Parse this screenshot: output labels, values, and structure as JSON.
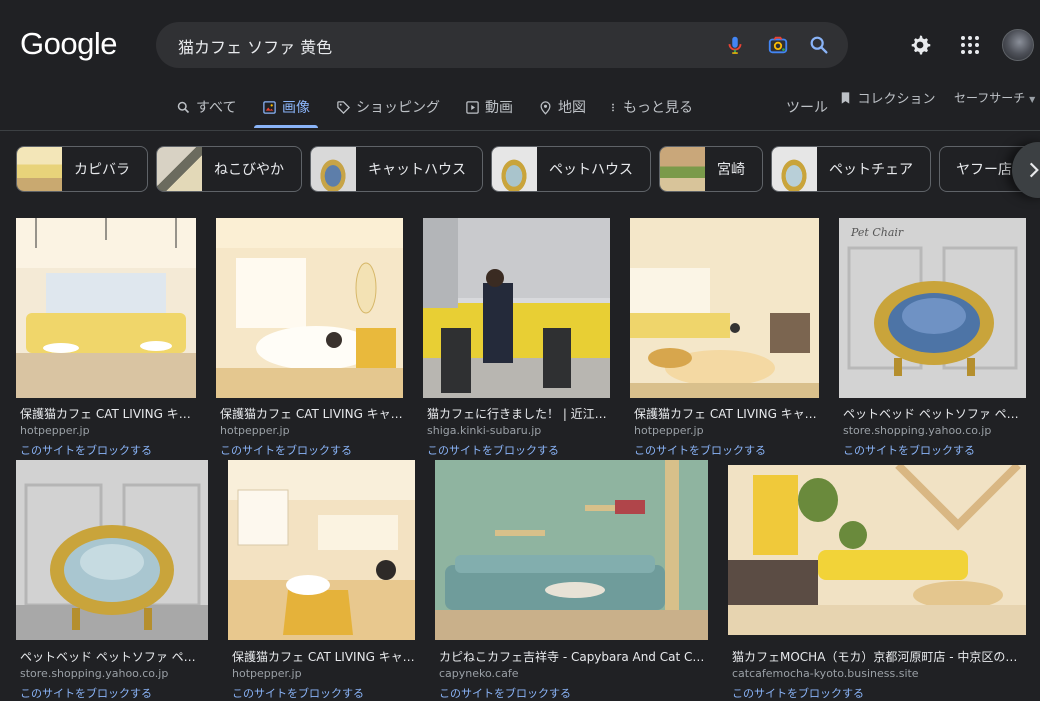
{
  "brand": {
    "logo_text": "Google"
  },
  "search": {
    "query": "猫カフェ ソファ 黄色"
  },
  "icons": {
    "mic": "microphone-icon",
    "lens": "camera-lens-icon",
    "search": "search-icon",
    "settings": "gear-icon",
    "apps": "apps-grid-icon"
  },
  "tabs": [
    {
      "label": "すべて",
      "icon": "search-icon"
    },
    {
      "label": "画像",
      "icon": "image-icon",
      "active": true
    },
    {
      "label": "ショッピング",
      "icon": "tag-icon"
    },
    {
      "label": "動画",
      "icon": "play-icon"
    },
    {
      "label": "地図",
      "icon": "map-pin-icon"
    },
    {
      "label": "もっと見る",
      "icon": "more-vert-icon"
    }
  ],
  "right_tools": {
    "tools": "ツール",
    "collection": "コレクション",
    "safesearch": "セーフサーチ"
  },
  "chips": [
    {
      "label": "カピバラ"
    },
    {
      "label": "ねこびやか"
    },
    {
      "label": "キャットハウス"
    },
    {
      "label": "ペットハウス"
    },
    {
      "label": "宮崎"
    },
    {
      "label": "ペットチェア"
    },
    {
      "label": "ヤフー店"
    }
  ],
  "results": [
    {
      "caption": "保護猫カフェ CAT LIVING キャ…",
      "source": "hotpepper.jp",
      "block": "このサイトをブロックする"
    },
    {
      "caption": "保護猫カフェ CAT LIVING キャ…",
      "source": "hotpepper.jp",
      "block": "このサイトをブロックする"
    },
    {
      "caption": "猫カフェに行きました！ | 近江…",
      "source": "shiga.kinki-subaru.jp",
      "block": "このサイトをブロックする"
    },
    {
      "caption": "保護猫カフェ CAT LIVING キャ…",
      "source": "hotpepper.jp",
      "block": "このサイトをブロックする"
    },
    {
      "caption": "ペットベッド ペットソファ ペ…",
      "source": "store.shopping.yahoo.co.jp",
      "block": "このサイトをブロックする",
      "overlay": "Pet Chair"
    },
    {
      "caption": "ペットベッド ペットソファ ペ…",
      "source": "store.shopping.yahoo.co.jp",
      "block": "このサイトをブロックする"
    },
    {
      "caption": "保護猫カフェ CAT LIVING キャ…",
      "source": "hotpepper.jp",
      "block": "このサイトをブロックする"
    },
    {
      "caption": "カピねこカフェ吉祥寺 - Capybara And Cat Caf…",
      "source": "capyneko.cafe",
      "block": "このサイトをブロックする"
    },
    {
      "caption": "猫カフェMOCHA（モカ）京都河原町店 - 中京区の…",
      "source": "catcafemocha-kyoto.business.site",
      "block": "このサイトをブロックする"
    }
  ],
  "colors": {
    "background": "#202124",
    "accent": "#8ab4f8",
    "search_bg": "#303134"
  }
}
